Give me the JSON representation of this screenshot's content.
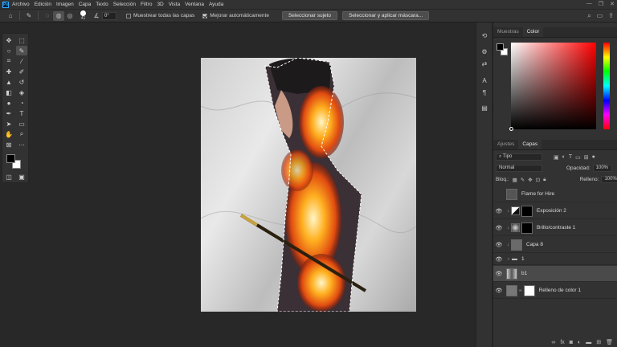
{
  "menubar": {
    "logo": "Ps",
    "items": [
      "Archivo",
      "Edición",
      "Imagen",
      "Capa",
      "Texto",
      "Selección",
      "Filtro",
      "3D",
      "Vista",
      "Ventana",
      "Ayuda"
    ],
    "window_buttons": [
      "—",
      "❐",
      "✕"
    ]
  },
  "options_bar": {
    "brush_size": "41",
    "angle_value": "0°",
    "sample_all_label": "Muestrear todas las capas",
    "sample_all_checked": false,
    "auto_enhance_label": "Mejorar automáticamente",
    "auto_enhance_checked": true,
    "select_subject_label": "Seleccionar sujeto",
    "select_mask_label": "Seleccionar y aplicar máscara..."
  },
  "toolbar": {
    "icons": [
      "move-icon",
      "marquee-icon",
      "lasso-icon",
      "quick-selection-icon",
      "crop-icon",
      "eyedropper-icon",
      "healing-icon",
      "brush-icon",
      "stamp-icon",
      "history-brush-icon",
      "eraser-icon",
      "bucket-icon",
      "blur-icon",
      "dodge-icon",
      "pen-icon",
      "type-icon",
      "path-select-icon",
      "shape-icon",
      "hand-icon",
      "zoom-icon",
      "frame-icon",
      "more-icon"
    ]
  },
  "color_panel": {
    "tabs": [
      "Muestras",
      "Color"
    ],
    "active_tab": "Color",
    "foreground": "#000000",
    "background": "#ffffff",
    "picker_hue": "#ff0000"
  },
  "layers_panel": {
    "tabs": [
      "Ajustes",
      "Capas"
    ],
    "active_tab": "Capas",
    "filter_label": "Tipo",
    "blend_mode": "Normal",
    "opacity_label": "Opacidad:",
    "opacity_value": "100%",
    "lock_label": "Bloq.:",
    "fill_label": "Relleno:",
    "fill_value": "100%",
    "layers": [
      {
        "name": "Flame for Hire",
        "visible": false,
        "selected": false
      },
      {
        "name": "Exposición 2",
        "visible": true,
        "selected": false
      },
      {
        "name": "Brillo/contraste 1",
        "visible": true,
        "selected": false
      },
      {
        "name": "Capa 8",
        "visible": true,
        "selected": false
      },
      {
        "name": "1",
        "visible": true,
        "selected": false
      },
      {
        "name": "b1",
        "visible": true,
        "selected": true
      },
      {
        "name": "Relleno de color 1",
        "visible": true,
        "selected": false
      }
    ]
  }
}
